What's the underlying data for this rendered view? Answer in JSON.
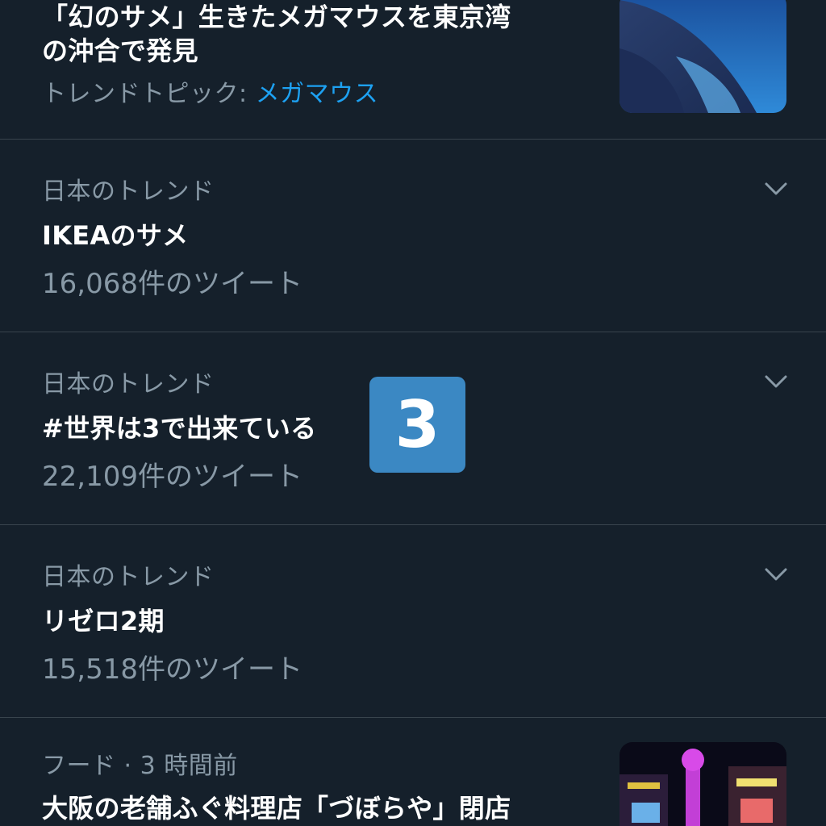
{
  "trends": [
    {
      "title_line1": "「幻のサメ」生きたメガマウスを東京湾",
      "title_line2": "の沖合で発見",
      "topic_prefix": "トレンドトピック: ",
      "topic_link": "メガマウス"
    },
    {
      "category": "日本のトレンド",
      "title": "IKEAのサメ",
      "tweet_count": "16,068件のツイート"
    },
    {
      "category": "日本のトレンド",
      "title": "#世界は3で出来ている",
      "emoji": "3",
      "tweet_count": "22,109件のツイート"
    },
    {
      "category": "日本のトレンド",
      "title": "リゼロ2期",
      "tweet_count": "15,518件のツイート"
    },
    {
      "category": "フード · 3 時間前",
      "title": "大阪の老舗ふぐ料理店「づぼらや」閉店"
    }
  ],
  "colors": {
    "background": "#15202b",
    "divider": "#38444d",
    "secondary_text": "#8899a6",
    "link": "#1da1f2",
    "emoji_keycap": "#3b88c3"
  },
  "icons": {
    "more": "chevron-down-icon",
    "emoji": "keycap-3-emoji"
  }
}
